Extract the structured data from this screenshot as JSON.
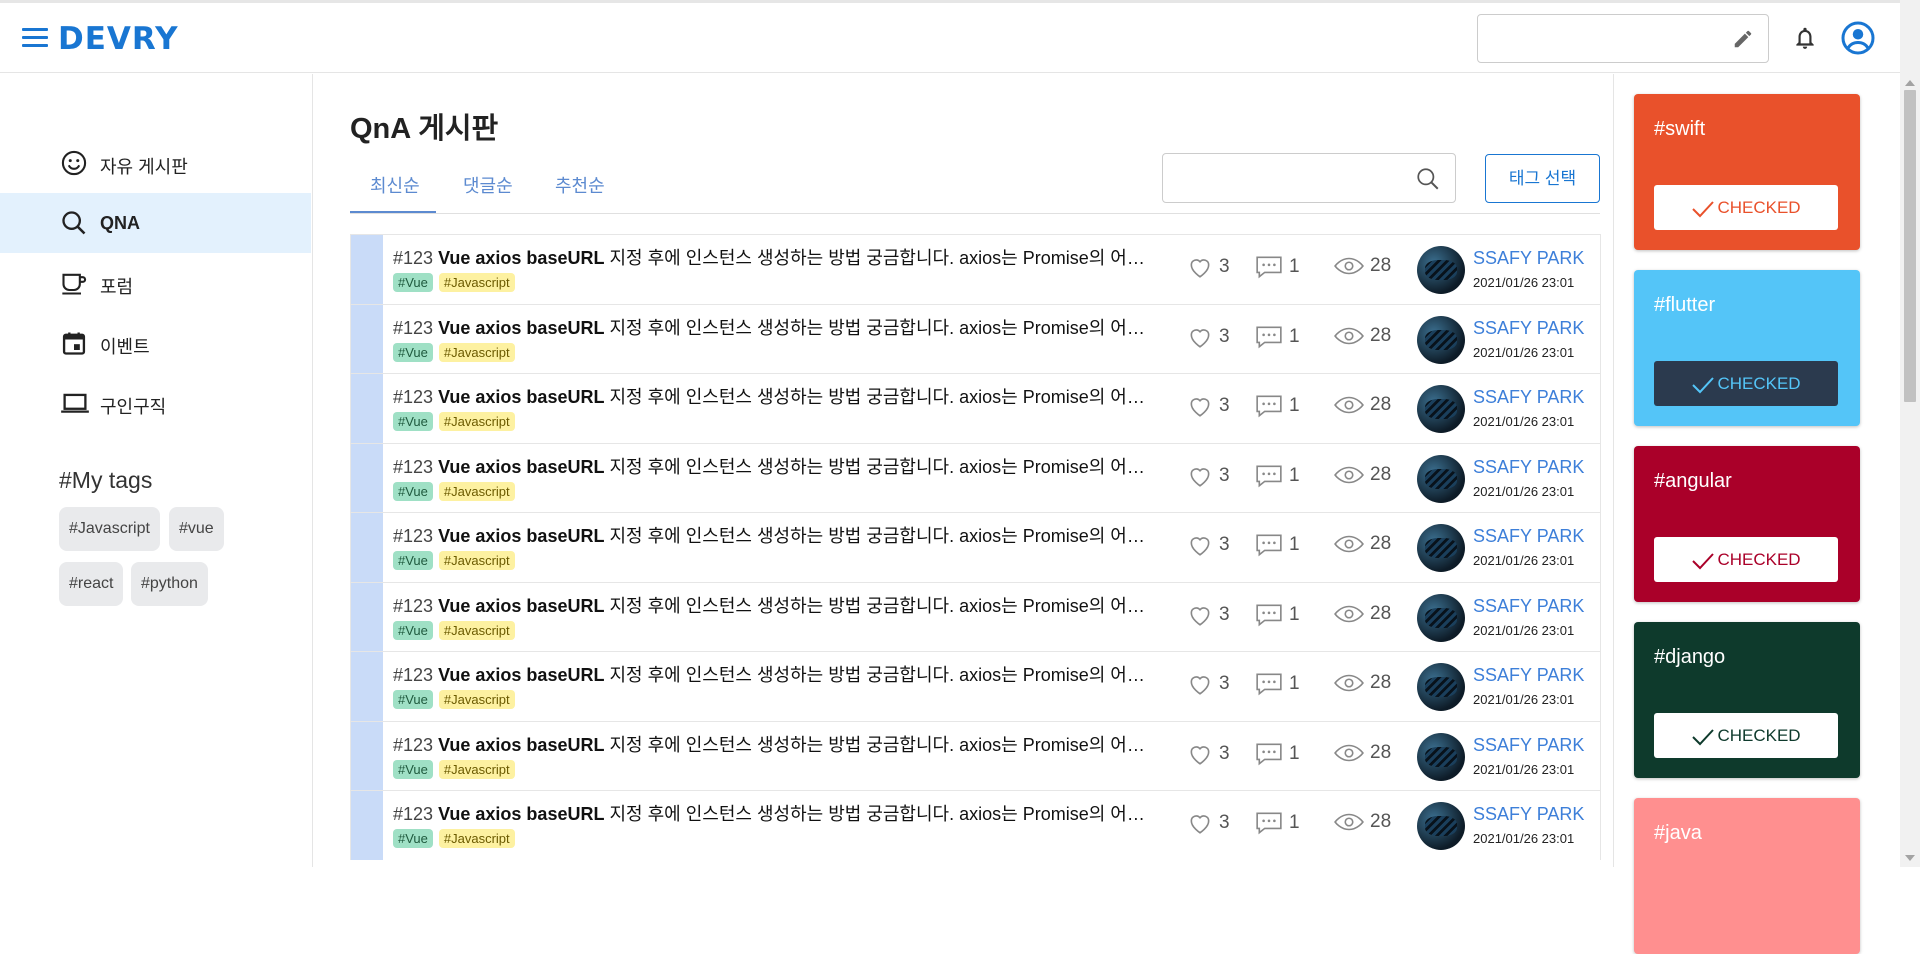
{
  "header": {
    "logo": "DEVRY",
    "menu_icon": "menu-icon",
    "search_icon": "pencil-icon",
    "notification_icon": "bell-icon",
    "profile_icon": "account-circle-icon"
  },
  "sidebar": {
    "items": [
      {
        "label": "자유 게시판",
        "icon": "smile-icon",
        "active": false
      },
      {
        "label": "QNA",
        "icon": "search-icon",
        "active": true
      },
      {
        "label": "포럼",
        "icon": "cup-icon",
        "active": false
      },
      {
        "label": "이벤트",
        "icon": "calendar-icon",
        "active": false
      },
      {
        "label": "구인구직",
        "icon": "laptop-icon",
        "active": false
      }
    ],
    "mytags_title": "#My tags",
    "mytags": [
      "#Javascript",
      "#vue",
      "#react",
      "#python"
    ]
  },
  "board": {
    "title": "QnA 게시판",
    "tabs": [
      "최신순",
      "댓글순",
      "추천순"
    ],
    "active_tab": "최신순",
    "tag_select_label": "태그 선택",
    "posts": [
      {
        "num": "#123",
        "subject": "Vue axios baseURL",
        "rest": " 지정 후에 인스턴스 생성하는 방법 궁금합니다. axios는 Promise의 어떤 방식을 사용하나요?",
        "tags": [
          "#Vue",
          "#Javascript"
        ],
        "likes": "3",
        "comments": "1",
        "views": "28",
        "author": "SSAFY PARK",
        "date": "2021/01/26 23:01"
      },
      {
        "num": "#123",
        "subject": "Vue axios baseURL",
        "rest": " 지정 후에 인스턴스 생성하는 방법 궁금합니다. axios는 Promise의 어떤 방식을 사용하나요?",
        "tags": [
          "#Vue",
          "#Javascript"
        ],
        "likes": "3",
        "comments": "1",
        "views": "28",
        "author": "SSAFY PARK",
        "date": "2021/01/26 23:01"
      },
      {
        "num": "#123",
        "subject": "Vue axios baseURL",
        "rest": " 지정 후에 인스턴스 생성하는 방법 궁금합니다. axios는 Promise의 어떤 방식을 사용하나요?",
        "tags": [
          "#Vue",
          "#Javascript"
        ],
        "likes": "3",
        "comments": "1",
        "views": "28",
        "author": "SSAFY PARK",
        "date": "2021/01/26 23:01"
      },
      {
        "num": "#123",
        "subject": "Vue axios baseURL",
        "rest": " 지정 후에 인스턴스 생성하는 방법 궁금합니다. axios는 Promise의 어떤 방식을 사용하나요?",
        "tags": [
          "#Vue",
          "#Javascript"
        ],
        "likes": "3",
        "comments": "1",
        "views": "28",
        "author": "SSAFY PARK",
        "date": "2021/01/26 23:01"
      },
      {
        "num": "#123",
        "subject": "Vue axios baseURL",
        "rest": " 지정 후에 인스턴스 생성하는 방법 궁금합니다. axios는 Promise의 어떤 방식을 사용하나요?",
        "tags": [
          "#Vue",
          "#Javascript"
        ],
        "likes": "3",
        "comments": "1",
        "views": "28",
        "author": "SSAFY PARK",
        "date": "2021/01/26 23:01"
      },
      {
        "num": "#123",
        "subject": "Vue axios baseURL",
        "rest": " 지정 후에 인스턴스 생성하는 방법 궁금합니다. axios는 Promise의 어떤 방식을 사용하나요?",
        "tags": [
          "#Vue",
          "#Javascript"
        ],
        "likes": "3",
        "comments": "1",
        "views": "28",
        "author": "SSAFY PARK",
        "date": "2021/01/26 23:01"
      },
      {
        "num": "#123",
        "subject": "Vue axios baseURL",
        "rest": " 지정 후에 인스턴스 생성하는 방법 궁금합니다. axios는 Promise의 어떤 방식을 사용하나요?",
        "tags": [
          "#Vue",
          "#Javascript"
        ],
        "likes": "3",
        "comments": "1",
        "views": "28",
        "author": "SSAFY PARK",
        "date": "2021/01/26 23:01"
      },
      {
        "num": "#123",
        "subject": "Vue axios baseURL",
        "rest": " 지정 후에 인스턴스 생성하는 방법 궁금합니다. axios는 Promise의 어떤 방식을 사용하나요?",
        "tags": [
          "#Vue",
          "#Javascript"
        ],
        "likes": "3",
        "comments": "1",
        "views": "28",
        "author": "SSAFY PARK",
        "date": "2021/01/26 23:01"
      },
      {
        "num": "#123",
        "subject": "Vue axios baseURL",
        "rest": " 지정 후에 인스턴스 생성하는 방법 궁금합니다. axios는 Promise의 어떤 방식을 사용하나요?",
        "tags": [
          "#Vue",
          "#Javascript"
        ],
        "likes": "3",
        "comments": "1",
        "views": "28",
        "author": "SSAFY PARK",
        "date": "2021/01/26 23:01"
      }
    ]
  },
  "tag_cards": [
    {
      "name": "#swift",
      "button": "CHECKED",
      "bg": "#e9512b",
      "btn_bg": "#ffffff",
      "btn_color": "#e9512b"
    },
    {
      "name": "#flutter",
      "button": "CHECKED",
      "bg": "#54c5f8",
      "btn_bg": "#2b3a4e",
      "btn_color": "#54c5f8"
    },
    {
      "name": "#angular",
      "button": "CHECKED",
      "bg": "#aa0029",
      "btn_bg": "#ffffff",
      "btn_color": "#aa0029"
    },
    {
      "name": "#django",
      "button": "CHECKED",
      "bg": "#0e3a2c",
      "btn_bg": "#ffffff",
      "btn_color": "#0e3a2c"
    },
    {
      "name": "#java",
      "button": "",
      "bg": "#ff8f8f",
      "btn_bg": "",
      "btn_color": ""
    }
  ],
  "colors": {
    "accent": "#1976d2",
    "link": "#3d7fd9",
    "active_nav_bg": "#e3f1fd"
  }
}
